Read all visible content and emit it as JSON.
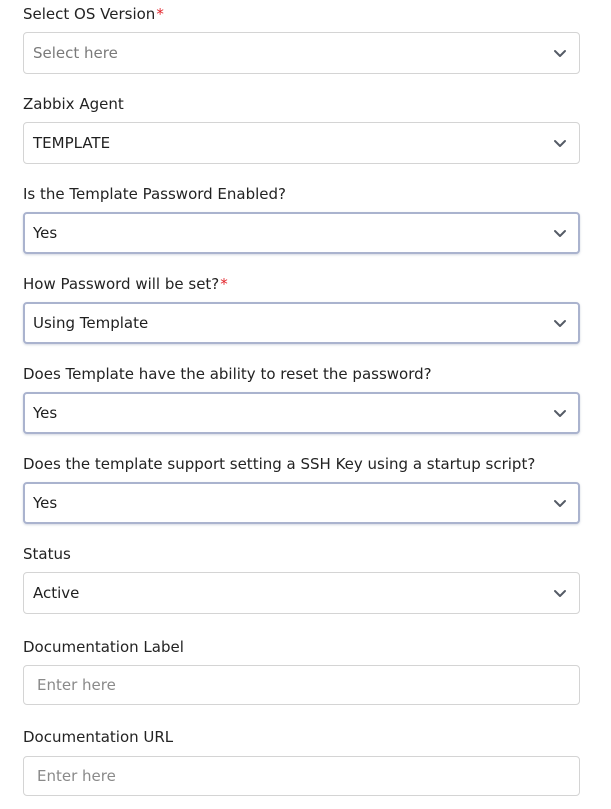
{
  "fields": {
    "os_version": {
      "label": "Select OS Version",
      "required_mark": "*",
      "placeholder": "Select here"
    },
    "zabbix_agent": {
      "label": "Zabbix Agent",
      "value": "TEMPLATE"
    },
    "template_password_enabled": {
      "label": "Is the Template Password Enabled?",
      "value": "Yes"
    },
    "password_set_method": {
      "label": "How Password will be set?",
      "required_mark": "*",
      "value": "Using Template"
    },
    "template_reset_password": {
      "label": "Does Template have the ability to reset the password?",
      "value": "Yes"
    },
    "ssh_key_startup_script": {
      "label": "Does the template support setting a SSH Key using a startup script?",
      "value": "Yes"
    },
    "status": {
      "label": "Status",
      "value": "Active"
    },
    "documentation_label": {
      "label": "Documentation Label",
      "placeholder": "Enter here"
    },
    "documentation_url": {
      "label": "Documentation URL",
      "placeholder": "Enter here"
    }
  },
  "icons": {
    "dropdown": "chevron-down-icon"
  },
  "colors": {
    "required": "#e3242b",
    "active_border": "#aab3ce",
    "border": "#d4d4d4",
    "placeholder": "#7a7a7a"
  }
}
